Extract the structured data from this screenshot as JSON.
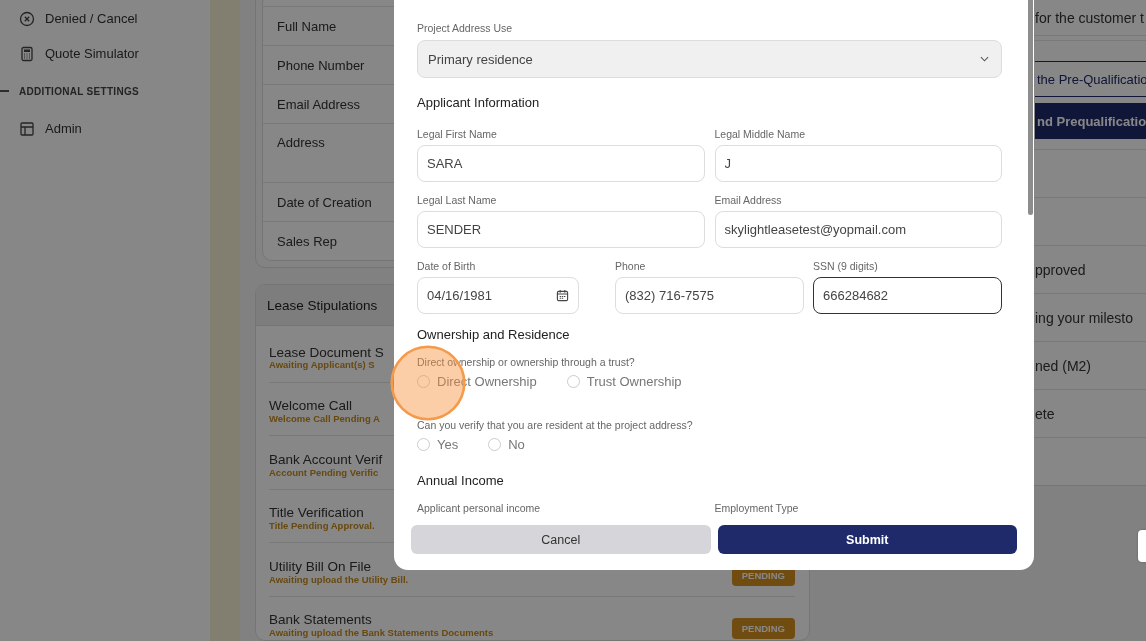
{
  "sidebar": {
    "items": [
      {
        "label": "Denied / Cancel"
      },
      {
        "label": "Quote Simulator"
      }
    ],
    "section_title": "ADDITIONAL SETTINGS",
    "section_items": [
      {
        "label": "Admin"
      }
    ]
  },
  "customer_card": {
    "fields": [
      {
        "label": "Full Name",
        "kind": "single"
      },
      {
        "label": "Phone Number",
        "kind": "single"
      },
      {
        "label": "Email Address",
        "kind": "single"
      },
      {
        "label": "Address",
        "kind": "multiline"
      },
      {
        "label": "Date of Creation",
        "kind": "single"
      },
      {
        "label": "Sales Rep",
        "kind": "single"
      }
    ]
  },
  "stipulations": {
    "title": "Lease Stipulations",
    "items": [
      {
        "title": "Lease Document S",
        "status": "Awaiting Applicant(s) S"
      },
      {
        "title": "Welcome Call",
        "status": "Welcome Call Pending A"
      },
      {
        "title": "Bank Account Verif",
        "status": "Account Pending Verific"
      },
      {
        "title": "Title Verification",
        "status": "Title Pending Approval."
      },
      {
        "title": "Utility Bill On File",
        "status": "Awaiting upload the Utility Bill.",
        "badge": "PENDING"
      },
      {
        "title": "Bank Statements",
        "status": "Awaiting upload the Bank Statements Documents",
        "badge": "PENDING"
      }
    ]
  },
  "progress_panel": {
    "note": "for the customer t",
    "outline_button": "the Pre-Qualificatio",
    "primary_button": "nd Prequalificatio",
    "rows": [
      "pproved",
      "ing your milesto",
      "ned (M2)",
      "ete"
    ]
  },
  "modal": {
    "select": {
      "label": "Project Address Use",
      "value": "Primary residence"
    },
    "applicant_heading": "Applicant Information",
    "fields": [
      {
        "label": "Legal First Name",
        "value": "SARA",
        "focused": false
      },
      {
        "label": "Legal Middle Name",
        "value": "J",
        "focused": false
      },
      {
        "label": "Legal Last Name",
        "value": "SENDER",
        "focused": false
      },
      {
        "label": "Email Address",
        "value": "skylightleasetest@yopmail.com",
        "focused": false
      }
    ],
    "date_field": {
      "label": "Date of Birth",
      "value": "04/16/1981"
    },
    "contact_fields": [
      {
        "label": "Phone",
        "value": "(832) 716-7575",
        "focused": false
      },
      {
        "label": "SSN (9 digits)",
        "value": "666284682",
        "focused": true
      }
    ],
    "ownership_heading": "Ownership and Residence",
    "questions": [
      {
        "text": "Direct ownership or ownership through a trust?",
        "options": [
          {
            "label": "Direct Ownership",
            "selected": false
          },
          {
            "label": "Trust Ownership",
            "selected": false
          }
        ]
      },
      {
        "text": "Can you verify that you are resident at the project address?",
        "options": [
          {
            "label": "Yes",
            "selected": false
          },
          {
            "label": "No",
            "selected": false
          }
        ]
      }
    ],
    "income_heading": "Annual Income",
    "income_labels": [
      "Applicant personal income",
      "Employment Type"
    ],
    "buttons": [
      {
        "label": "Cancel",
        "kind": "secondary"
      },
      {
        "label": "Submit",
        "kind": "primary"
      }
    ]
  }
}
